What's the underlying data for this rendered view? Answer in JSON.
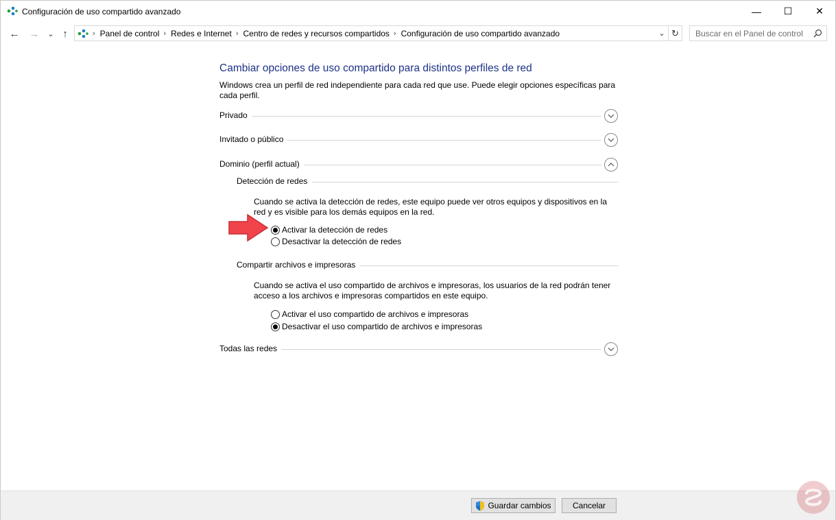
{
  "window": {
    "title": "Configuración de uso compartido avanzado",
    "buttons": {
      "minimize": "—",
      "maximize": "☐",
      "close": "✕"
    }
  },
  "nav": {
    "back": "←",
    "forward": "→",
    "recent": "⌄",
    "up": "↑",
    "breadcrumbs": [
      "Panel de control",
      "Redes e Internet",
      "Centro de redes y recursos compartidos",
      "Configuración de uso compartido avanzado"
    ],
    "separator": "›",
    "dropdown": "⌄",
    "refresh": "↻",
    "search_placeholder": "Buscar en el Panel de control"
  },
  "main": {
    "heading": "Cambiar opciones de uso compartido para distintos perfiles de red",
    "intro": "Windows crea un perfil de red independiente para cada red que use. Puede elegir opciones específicas para cada perfil.",
    "profiles": [
      {
        "label": "Privado",
        "expanded": false
      },
      {
        "label": "Invitado o público",
        "expanded": false
      },
      {
        "label": "Dominio (perfil actual)",
        "expanded": true
      },
      {
        "label": "Todas las redes",
        "expanded": false
      }
    ],
    "network_discovery": {
      "title": "Detección de redes",
      "description": "Cuando se activa la detección de redes, este equipo puede ver otros equipos y dispositivos en la red y es visible para los demás equipos en la red.",
      "options": [
        {
          "label": "Activar la detección de redes",
          "checked": true
        },
        {
          "label": "Desactivar la detección de redes",
          "checked": false
        }
      ]
    },
    "file_sharing": {
      "title": "Compartir archivos e impresoras",
      "description": "Cuando se activa el uso compartido de archivos e impresoras, los usuarios de la red podrán tener acceso a los archivos e impresoras compartidos en este equipo.",
      "options": [
        {
          "label": "Activar el uso compartido de archivos e impresoras",
          "checked": false
        },
        {
          "label": "Desactivar el uso compartido de archivos e impresoras",
          "checked": true
        }
      ]
    }
  },
  "footer": {
    "save_label": "Guardar cambios",
    "cancel_label": "Cancelar"
  },
  "colors": {
    "heading": "#1e3287",
    "annotation_arrow": "#f0444a",
    "watermark": "#c8323c"
  }
}
